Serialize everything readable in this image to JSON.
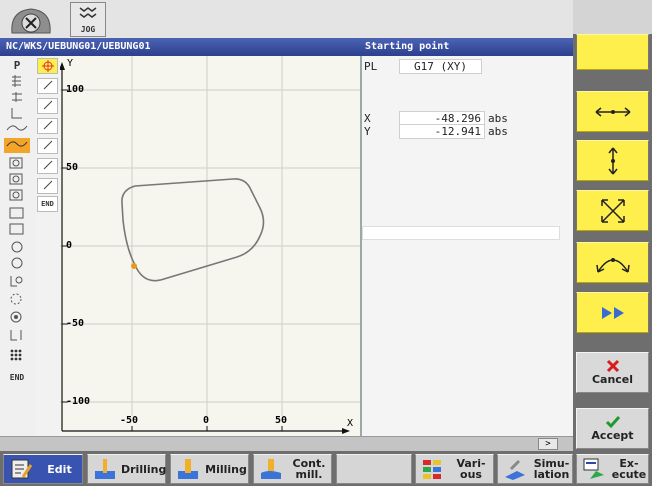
{
  "topbar": {
    "jog_label": "JOG",
    "mode_icon": "machine-mode-icon"
  },
  "header": {
    "path": "NC/WKS/UEBUNG01/UEBUNG01",
    "panel_title": "Starting point"
  },
  "tool_strip": {
    "top_label": "P",
    "bottom_label": "END",
    "icons": [
      "contour-start-icon",
      "line-horizontal-icon",
      "line-vertical-icon",
      "arc-icon",
      "arc-active-icon",
      "pocket-icon",
      "pocket-icon",
      "pocket-icon",
      "rect-pocket-icon",
      "rect-pocket-icon",
      "circle-icon",
      "circle-icon",
      "circle-pocket-icon",
      "drill-pattern-icon",
      "position-pattern-icon",
      "drill-pattern-icon",
      "grid-pattern-icon",
      "end-icon"
    ]
  },
  "element_list": {
    "end_label": "END",
    "items": [
      "start-point-icon",
      "line-diagonal-icon",
      "line-diagonal-icon",
      "line-diagonal-icon",
      "line-diagonal-icon",
      "line-diagonal-icon",
      "line-diagonal-icon"
    ]
  },
  "graphic": {
    "y_axis_label": "Y",
    "x_axis_label": "X",
    "y_ticks": [
      "100",
      "50",
      "0",
      "-50",
      "-100"
    ],
    "x_ticks": [
      "-50",
      "0",
      "50"
    ],
    "colors": {
      "contour": "#777777",
      "start_point": "#e89a1a",
      "axis": "#111111"
    }
  },
  "params": {
    "plane_label": "PL",
    "plane_value": "G17 (XY)",
    "x_label": "X",
    "x_value": "-48.296",
    "x_unit": "abs",
    "y_label": "Y",
    "y_value": "-12.941",
    "y_unit": "abs"
  },
  "status": {
    "more_label": ">"
  },
  "softkeys": {
    "icons": [
      "blank-softkey",
      "horizontal-tangent-icon",
      "vertical-tangent-icon",
      "all-directions-icon",
      "arc-direction-icon",
      "next-icon"
    ],
    "cancel_label": "Cancel",
    "accept_label": "Accept",
    "colors": {
      "softkey": "#ffef4d",
      "cancel": "#d81b1b",
      "accept": "#1e9a2c"
    }
  },
  "hbar": {
    "edit": "Edit",
    "drilling": "Drilling",
    "milling": "Milling",
    "contmill_1": "Cont.",
    "contmill_2": "mill.",
    "various_1": "Vari-",
    "various_2": "ous",
    "simulation_1": "Simu-",
    "simulation_2": "lation",
    "execute_1": "Ex-",
    "execute_2": "ecute"
  }
}
